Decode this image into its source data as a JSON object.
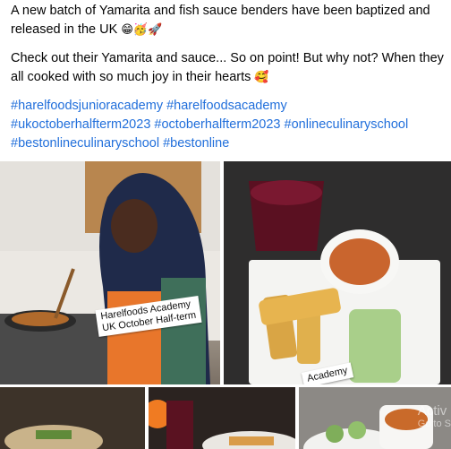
{
  "post": {
    "line1": "A new batch of Yamarita and fish sauce benders have been baptized and released in the UK",
    "line1_emojis": "😁🥳🚀",
    "line2": "Check out their Yamarita and sauce... So on point! But why not? When they all cooked with so much joy in their hearts",
    "line2_emoji": "🥰",
    "hashtags": [
      "#harelfoodsjunioracademy",
      "#harelfoodsacademy",
      "#ukoctoberhalfterm2023",
      "#octoberhalfterm2023",
      "#onlineculinaryschool",
      "#bestonlineculinaryschool",
      "#bestonline"
    ]
  },
  "photos": {
    "caption1_line1": "Harelfoods Academy",
    "caption1_line2": "UK October Half-term",
    "caption2": "Academy"
  },
  "watermark": {
    "title": "Activ",
    "sub": "Go to S"
  }
}
